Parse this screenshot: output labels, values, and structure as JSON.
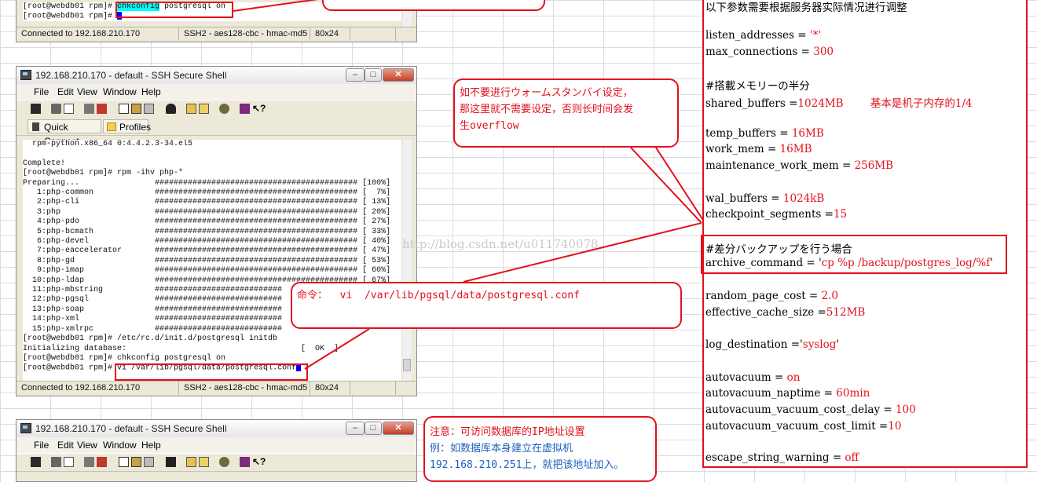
{
  "window_top": {
    "cmd_prompt": "[root@webdb01 rpm]# ",
    "cmd_highlight": "chkconfig",
    "cmd_rest": " postgresql on",
    "cmd_prompt2": "[root@webdb01 rpm]# ",
    "status": {
      "connected": "Connected to 192.168.210.170",
      "cipher": "SSH2 - aes128-cbc - hmac-md5",
      "size": "80x24"
    }
  },
  "window_mid": {
    "title": "192.168.210.170 - default - SSH Secure Shell",
    "menu": [
      "File",
      "Edit",
      "View",
      "Window",
      "Help"
    ],
    "quick_connect": "Quick Connect",
    "profiles": "Profiles",
    "terminal_lines": [
      "  rpm-python.x86_64 0:4.4.2.3-34.el5",
      "",
      "Complete!",
      "[root@webdb01 rpm]# rpm -ihv php-*",
      "Preparing...                ########################################### [100%]",
      "   1:php-common             ########################################### [  7%]",
      "   2:php-cli                ########################################### [ 13%]",
      "   3:php                    ########################################### [ 20%]",
      "   4:php-pdo                ########################################### [ 27%]",
      "   5:php-bcmath             ########################################### [ 33%]",
      "   6:php-devel              ########################################### [ 40%]",
      "   7:php-eaccelerator       ########################################### [ 47%]",
      "   8:php-gd                 ########################################### [ 53%]",
      "   9:php-imap               ########################################### [ 60%]",
      "  10:php-ldap               ########################################### [ 67%]",
      "  11:php-mbstring           ###########################",
      "  12:php-pgsql              ###########################",
      "  13:php-soap               ###########################",
      "  14:php-xml                ###########################",
      "  15:php-xmlrpc             ###########################",
      "[root@webdb01 rpm]# /etc/rc.d/init.d/postgresql initdb",
      "Initializing database:                                     [  OK  ]",
      "[root@webdb01 rpm]# chkconfig postgresql on"
    ],
    "last_prompt": "[root@webdb01 rpm]# ",
    "last_cmd": "vi /var/lib/pgsql/data/postgresql.conf",
    "status": {
      "connected": "Connected to 192.168.210.170",
      "cipher": "SSH2 - aes128-cbc - hmac-md5",
      "size": "80x24"
    }
  },
  "window_bottom": {
    "title": "192.168.210.170 - default - SSH Secure Shell",
    "menu": [
      "File",
      "Edit",
      "View",
      "Window",
      "Help"
    ]
  },
  "callouts": {
    "warm_standby": [
      "如不要进行ウォームスタンバイ设定，",
      "那这里就不需要设定，否则长时间会发",
      "生overflow"
    ],
    "command": "命令：  vi  /var/lib/pgsql/data/postgresql.conf",
    "note": [
      "注意：可访问数据库的IP地址设置",
      "例：如数据库本身建立在虚拟机",
      "192.168.210.251上，就把该地址加入。"
    ]
  },
  "watermark": "http://blog.csdn.net/u011740078",
  "config": {
    "header": "以下参数需要根据服务器实际情况进行调整",
    "lines": [
      {
        "k": "listen_addresses = ",
        "v": "'*'"
      },
      {
        "k": "max_connections = ",
        "v": "300"
      },
      {
        "k": "#搭載メモリーの半分",
        "v": ""
      },
      {
        "k": "shared_buffers =",
        "v": "1024MB        基本是机子内存的1/4"
      },
      {
        "k": "temp_buffers = ",
        "v": "16MB"
      },
      {
        "k": "work_mem = ",
        "v": "16MB"
      },
      {
        "k": "maintenance_work_mem = ",
        "v": "256MB"
      },
      {
        "k": "wal_buffers = ",
        "v": "1024kB"
      },
      {
        "k": "checkpoint_segments =",
        "v": "15"
      },
      {
        "k": "#差分バックアップを行う場合",
        "v": ""
      },
      {
        "k": "archive_command = '",
        "v": "cp %p /backup/postgres_log/%f",
        "tail": "'"
      },
      {
        "k": "random_page_cost = ",
        "v": "2.0"
      },
      {
        "k": "effective_cache_size =",
        "v": "512MB"
      },
      {
        "k": "log_destination ='",
        "v": "syslog",
        "tail": "'"
      },
      {
        "k": "autovacuum = ",
        "v": "on"
      },
      {
        "k": "autovacuum_naptime = ",
        "v": "60min"
      },
      {
        "k": "autovacuum_vacuum_cost_delay = ",
        "v": "100"
      },
      {
        "k": "autovacuum_vacuum_cost_limit =",
        "v": "10"
      },
      {
        "k": "escape_string_warning = ",
        "v": "off"
      }
    ]
  },
  "colors": {
    "accent_red": "#e3101c",
    "selection_cyan": "#00ffff",
    "cursor_blue": "#0000ff"
  }
}
